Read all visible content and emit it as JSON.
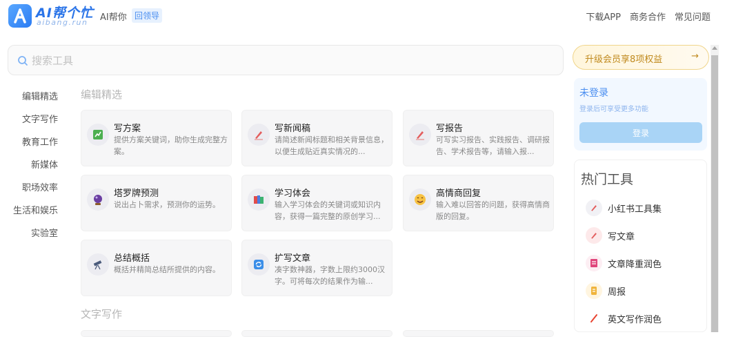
{
  "header": {
    "logo_text": "AI帮个忙",
    "logo_sub": "aibang.run",
    "slogan": "AI帮你",
    "slogan_tag": "回领导",
    "nav": [
      "下载APP",
      "商务合作",
      "常见问题"
    ]
  },
  "search": {
    "placeholder": "搜索工具",
    "value": ""
  },
  "categories": [
    "编辑精选",
    "文字写作",
    "教育工作",
    "新媒体",
    "职场效率",
    "生活和娱乐",
    "实验室"
  ],
  "sections": [
    {
      "title": "编辑精选",
      "cards": [
        {
          "title": "写方案",
          "desc": "提供方案关键词，助你生成完整方案。",
          "icon": "chart-icon"
        },
        {
          "title": "写新闻稿",
          "desc": "请简述新闻标题和相关背景信息，以便生成贴近真实情况的...",
          "icon": "pen-icon"
        },
        {
          "title": "写报告",
          "desc": "可写实习报告、实践报告、调研报告、学术报告等，请输入报...",
          "icon": "pen-icon"
        },
        {
          "title": "塔罗牌预测",
          "desc": "说出占卜需求，预测你的运势。",
          "icon": "crystal-ball-icon"
        },
        {
          "title": "学习体会",
          "desc": "输入学习体会的关键词或知识内容，获得一篇完整的原创学习...",
          "icon": "books-icon"
        },
        {
          "title": "高情商回复",
          "desc": "输入难以回答的问题，获得高情商版的回复。",
          "icon": "smile-icon"
        },
        {
          "title": "总结概括",
          "desc": "概括并精简总结所提供的内容。",
          "icon": "telescope-icon"
        },
        {
          "title": "扩写文章",
          "desc": "凑字数神器，字数上限约3000汉字。可将每次的结果作为输...",
          "icon": "refresh-icon"
        }
      ]
    },
    {
      "title": "文字写作",
      "cards": []
    }
  ],
  "sidebar": {
    "upgrade": {
      "label": "升级会员享8项权益",
      "arrow": "→"
    },
    "login": {
      "status": "未登录",
      "hint": "登录后可享受更多功能",
      "button": "登录"
    },
    "hot": {
      "title": "热门工具",
      "items": [
        {
          "label": "小红书工具集",
          "icon": "pen-icon"
        },
        {
          "label": "写文章",
          "icon": "pen-icon"
        },
        {
          "label": "文章降重润色",
          "icon": "doc-icon"
        },
        {
          "label": "周报",
          "icon": "scroll-icon"
        },
        {
          "label": "英文写作润色",
          "icon": "pencil-icon"
        }
      ]
    }
  },
  "colors": {
    "accent": "#4a8ef0",
    "gold": "#c08a1e",
    "muted": "#b6b6b6"
  }
}
